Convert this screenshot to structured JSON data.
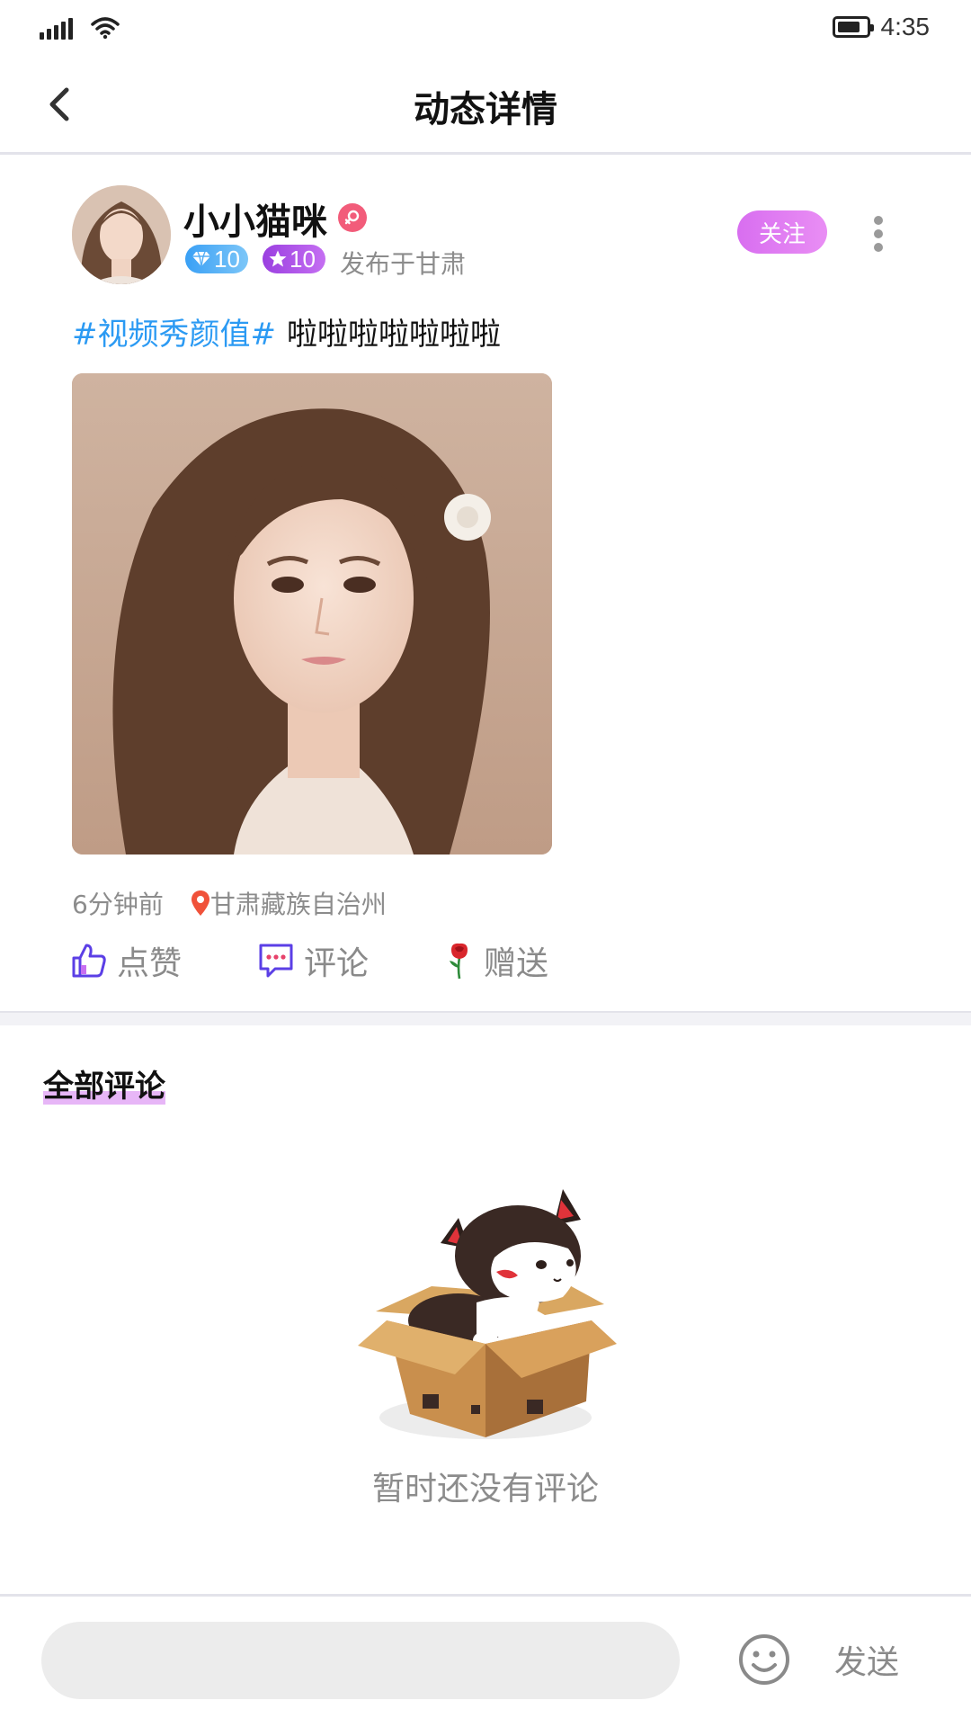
{
  "status_bar": {
    "time": "4:35",
    "icons": [
      "signal-icon",
      "wifi-icon",
      "battery-icon"
    ]
  },
  "nav": {
    "title": "动态详情",
    "back_icon": "chevron-left-icon"
  },
  "post": {
    "username": "小小猫咪",
    "gender_icon": "female-icon",
    "badges": [
      {
        "icon": "diamond-icon",
        "value": "10",
        "color": "#3aa0f5"
      },
      {
        "icon": "star-icon",
        "value": "10",
        "color": "#9a3fe0"
      }
    ],
    "published_at": "发布于甘肃",
    "follow_label": "关注",
    "hashtag": "#视频秀颜值#",
    "text": "啦啦啦啦啦啦啦",
    "time_ago": "6分钟前",
    "location": "甘肃藏族自治州",
    "actions": {
      "like": "点赞",
      "comment": "评论",
      "gift": "赠送"
    }
  },
  "comments": {
    "title": "全部评论",
    "empty_text": "暂时还没有评论"
  },
  "input_bar": {
    "placeholder": "",
    "send_label": "发送"
  },
  "colors": {
    "accent_purple": "#d86ef0",
    "hashtag_blue": "#2b9af3",
    "female_pink": "#f25c7a",
    "action_icon": "#5b3fe6"
  }
}
